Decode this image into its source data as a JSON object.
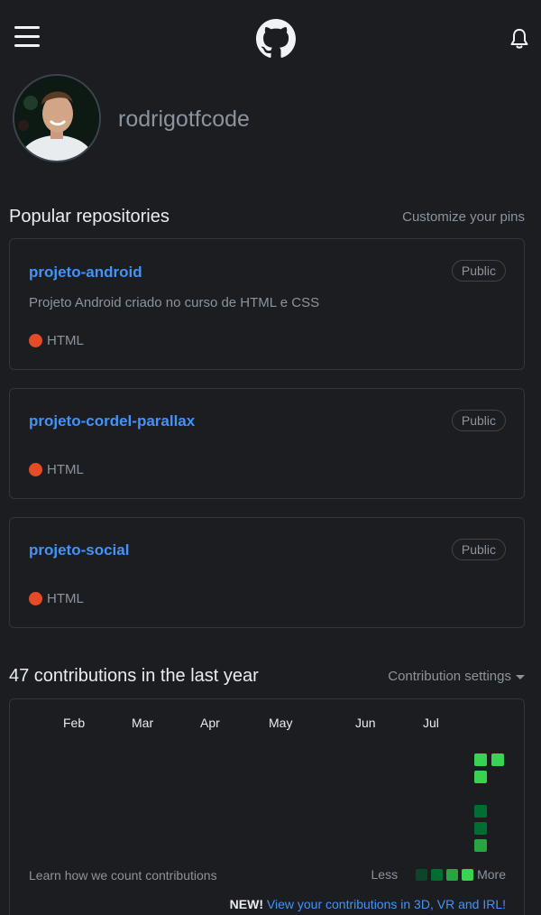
{
  "header": {
    "menu_icon": "hamburger-menu-icon",
    "logo_icon": "github-logo-icon",
    "bell_icon": "bell-icon"
  },
  "profile": {
    "username": "rodrigotfcode"
  },
  "popular": {
    "title": "Popular repositories",
    "customize": "Customize your pins",
    "repos": [
      {
        "name": "projeto-android",
        "visibility": "Public",
        "description": "Projeto Android criado no curso de HTML e CSS",
        "language": "HTML",
        "language_color": "#e34c26"
      },
      {
        "name": "projeto-cordel-parallax",
        "visibility": "Public",
        "description": "",
        "language": "HTML",
        "language_color": "#e34c26"
      },
      {
        "name": "projeto-social",
        "visibility": "Public",
        "description": "",
        "language": "HTML",
        "language_color": "#e34c26"
      }
    ]
  },
  "contributions": {
    "title": "47 contributions in the last year",
    "settings": "Contribution settings",
    "months": [
      "Feb",
      "Mar",
      "Apr",
      "May",
      "Jun",
      "Jul"
    ],
    "learn": "Learn how we count contributions",
    "legend_less": "Less",
    "legend_more": "More",
    "legend_colors": [
      "#0e4429",
      "#006d32",
      "#26a641",
      "#39d353"
    ],
    "new_label": "NEW!",
    "new_link": "View your contributions in 3D, VR and IRL!"
  },
  "colors": {
    "background": "#1b1d21",
    "link": "#4493f8",
    "muted": "#8b949e",
    "border": "#30363d"
  }
}
